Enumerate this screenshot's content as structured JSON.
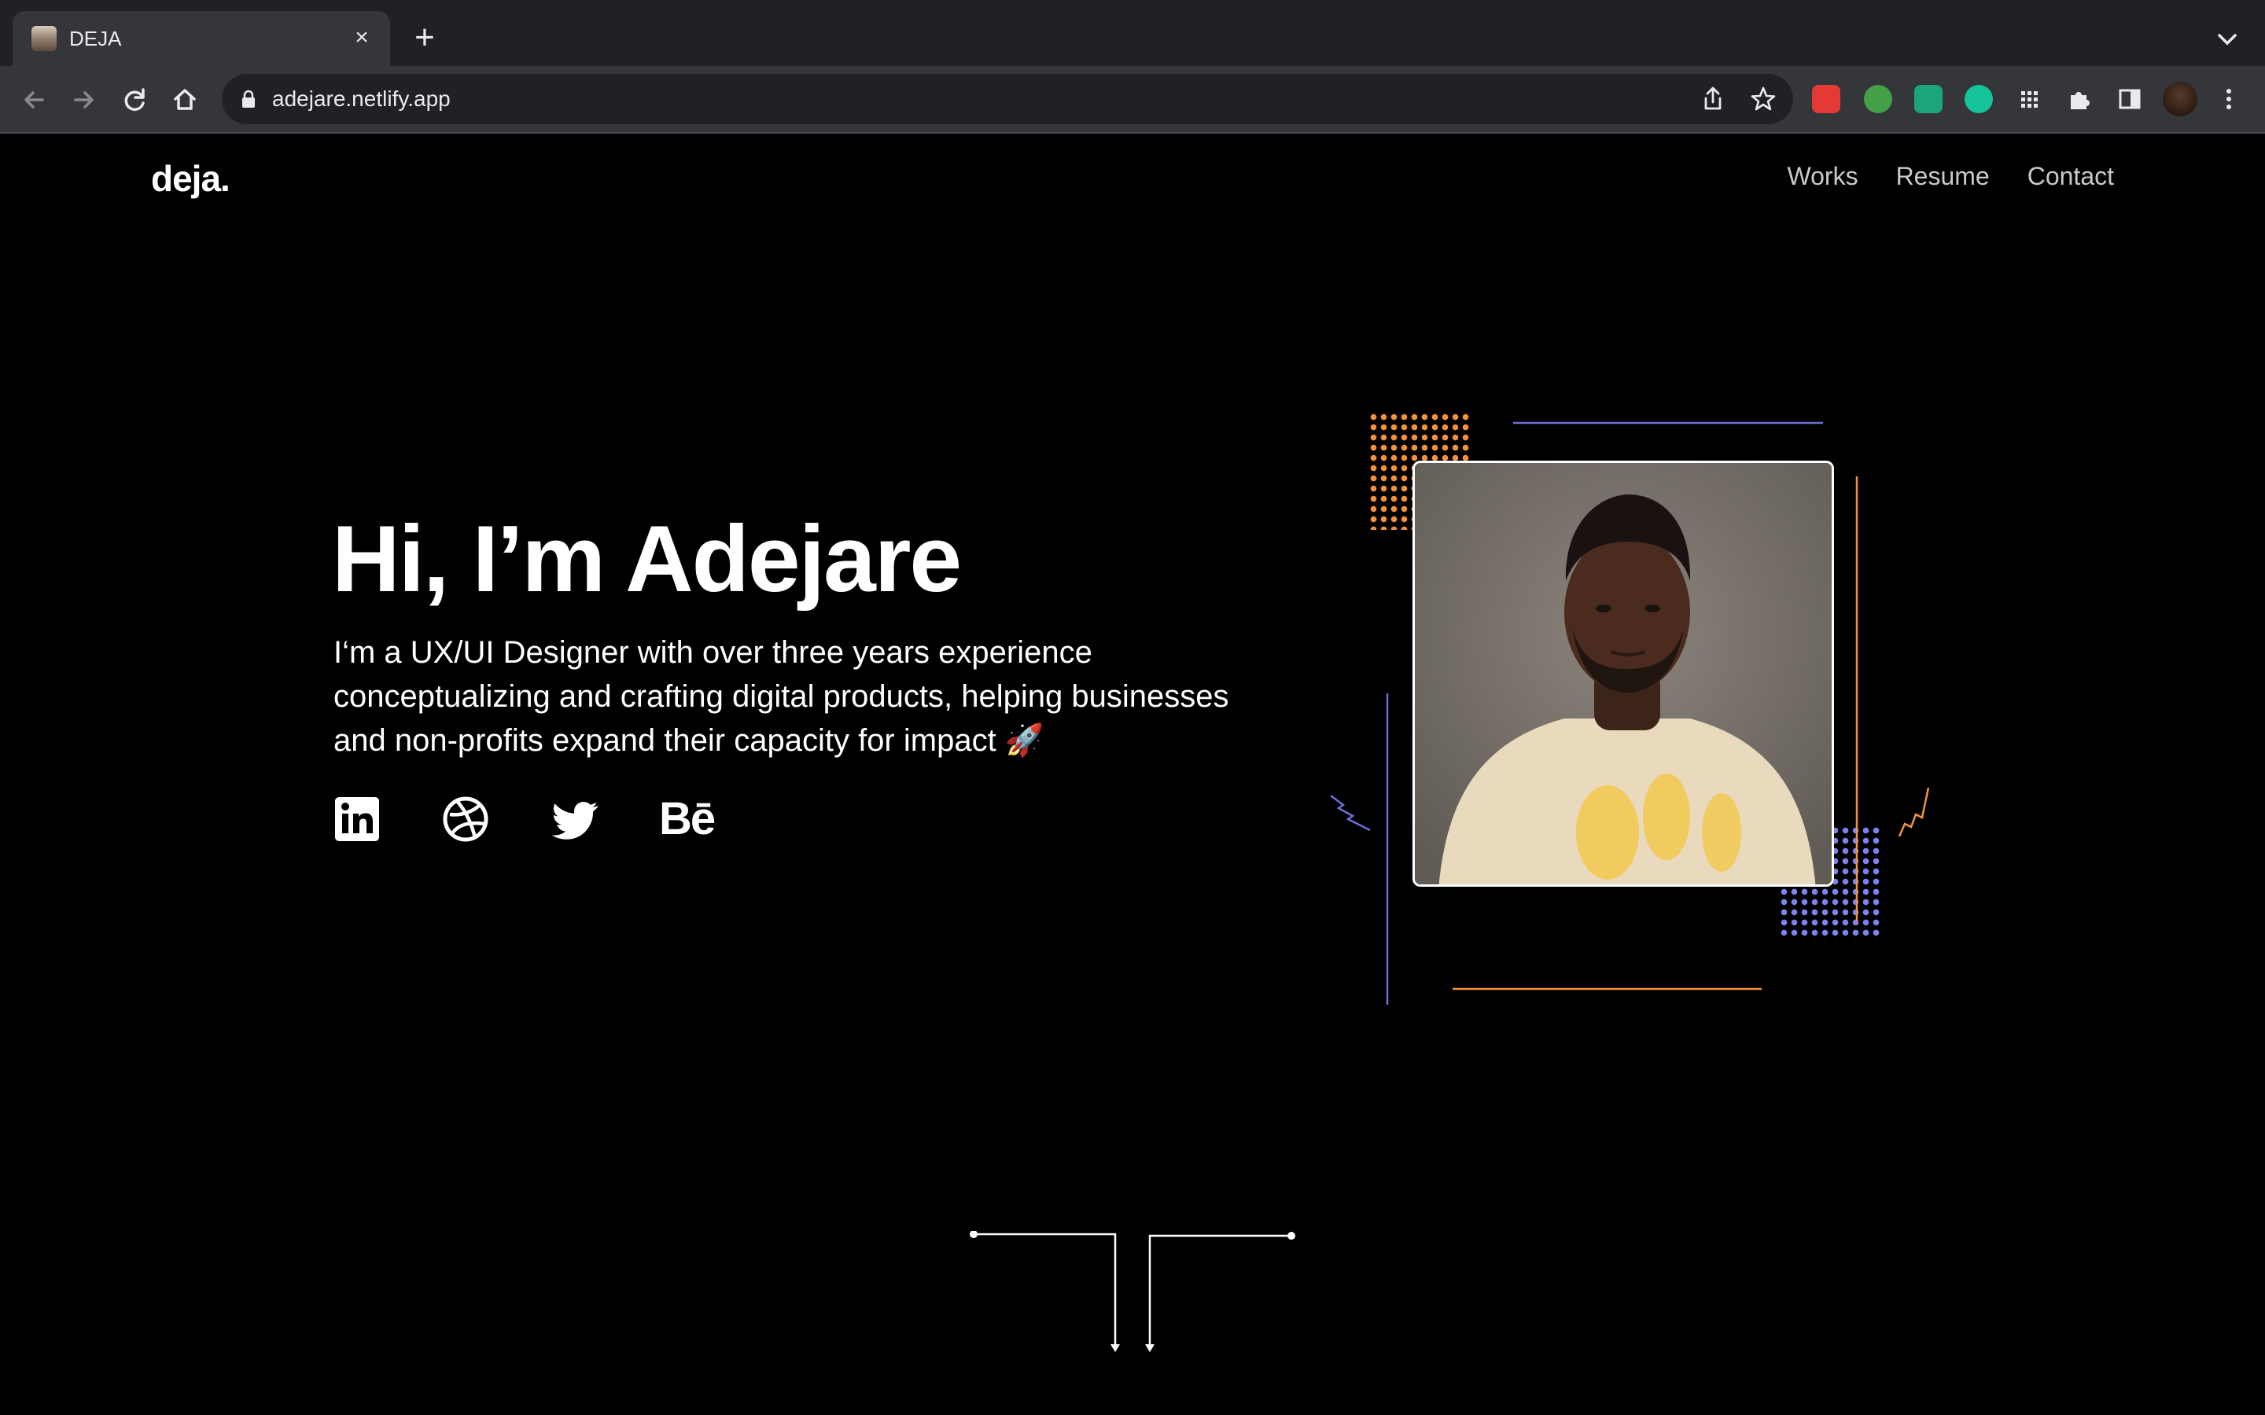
{
  "browser": {
    "tab_title": "DEJA",
    "url": "adejare.netlify.app"
  },
  "site": {
    "logo": "deja.",
    "nav": [
      "Works",
      "Resume",
      "Contact"
    ]
  },
  "hero": {
    "title": "Hi, I’m Adejare",
    "description": "I‘m a UX/UI Designer with over three years experience conceptualizing and crafting digital products, helping businesses and non-profits expand their capacity for impact 🚀",
    "socials": [
      {
        "name": "linkedin",
        "icon": "linkedin-icon"
      },
      {
        "name": "dribbble",
        "icon": "dribbble-icon"
      },
      {
        "name": "twitter",
        "icon": "twitter-icon"
      },
      {
        "name": "behance",
        "label": "Bē"
      }
    ]
  },
  "colors": {
    "accent_orange": "#f5913b",
    "accent_blue": "#7c83f2",
    "background": "#000000"
  }
}
